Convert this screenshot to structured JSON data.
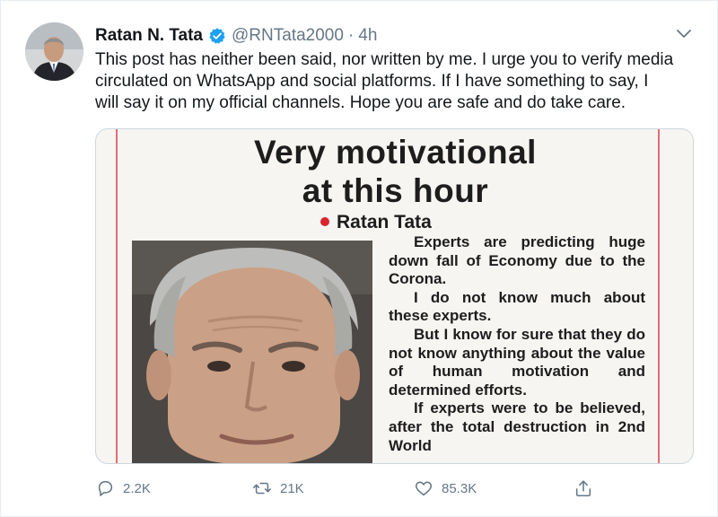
{
  "tweet": {
    "author_name": "Ratan N. Tata",
    "handle": "@RNTata2000",
    "separator": "·",
    "time": "4h",
    "text_lines": [
      "This post has neither been said, nor written by me. I urge you to verify media",
      "circulated on WhatsApp and social platforms. If I have something to say, I",
      "will say it on my official channels. Hope you are safe and do take care."
    ]
  },
  "media": {
    "title_lines": [
      "Very motivational",
      "at this hour"
    ],
    "byline": "Ratan Tata",
    "article_paragraphs": [
      "Experts are predicting huge down fall of Economy due to the Corona.",
      "I do not know much about these experts.",
      "But I know for sure that they do not know anything about the value of human motivation and determined efforts.",
      "If experts were to be believed, after the total destruction in 2nd World"
    ]
  },
  "actions": {
    "reply_count": "2.2K",
    "retweet_count": "21K",
    "like_count": "85.3K"
  },
  "icons": {
    "verified": "verified-badge-icon",
    "caret": "chevron-down-icon",
    "reply": "reply-icon",
    "retweet": "retweet-icon",
    "like": "heart-icon",
    "share": "share-icon"
  },
  "colors": {
    "verified_blue": "#1da1f2",
    "secondary_text": "#657786",
    "byline_red": "#d9232d"
  }
}
